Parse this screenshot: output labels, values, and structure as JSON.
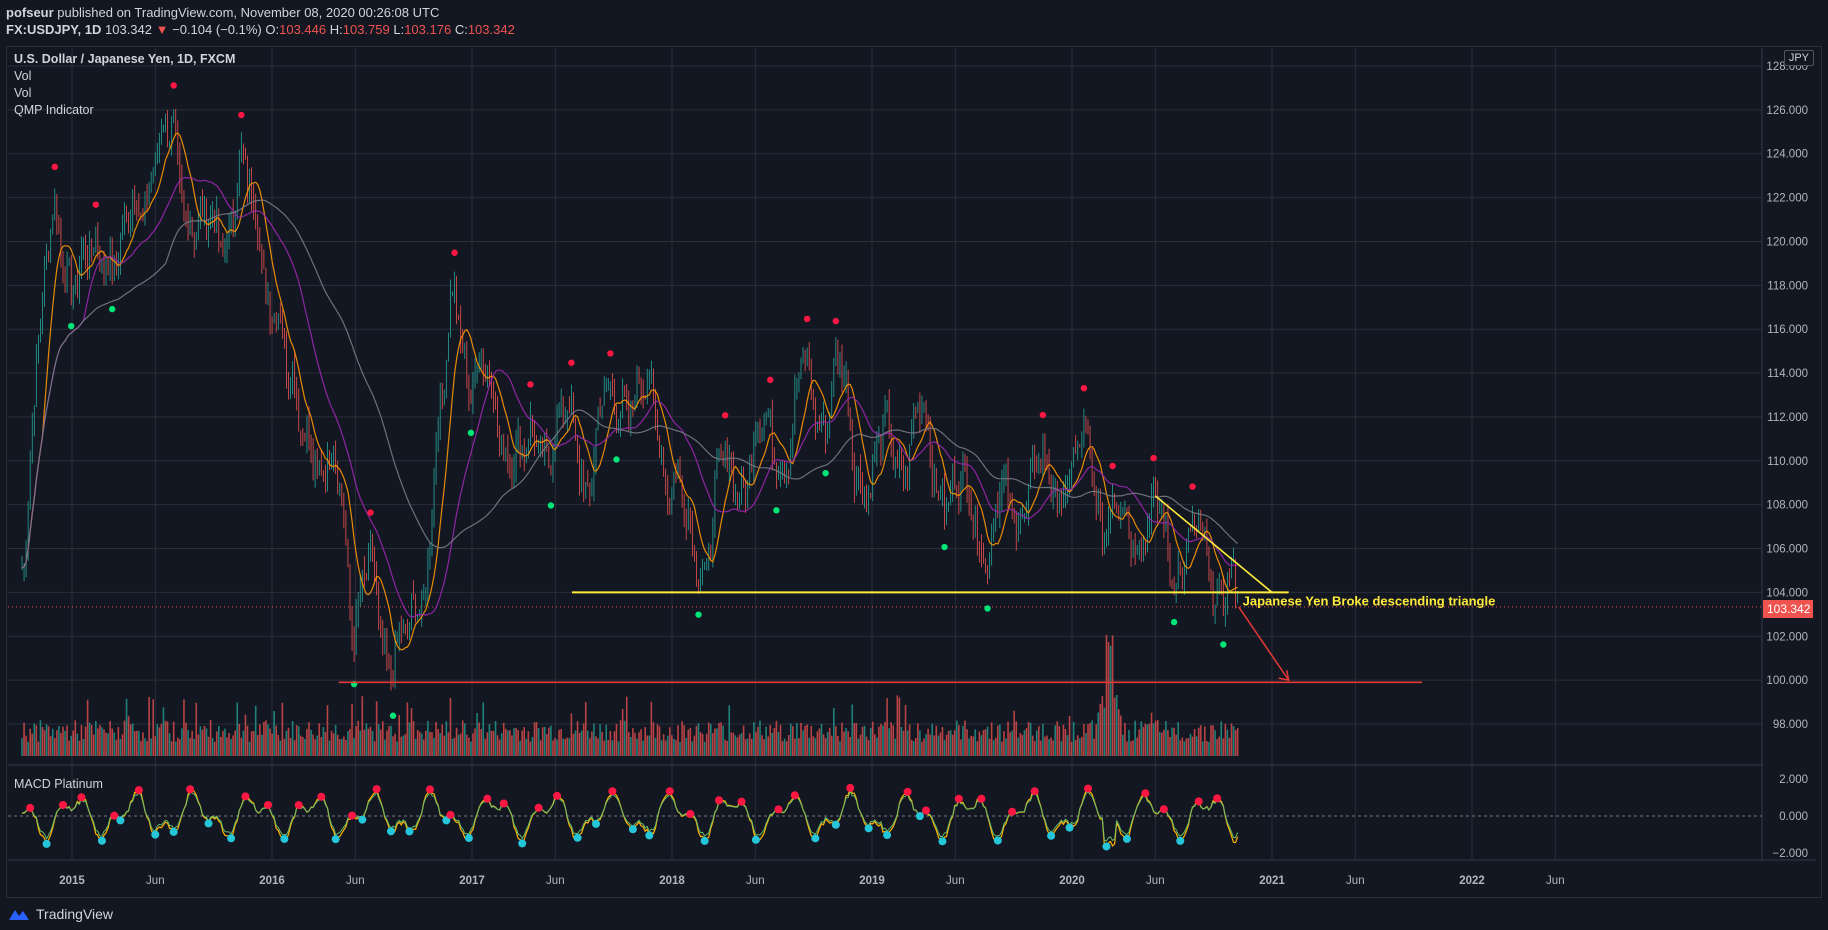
{
  "header": {
    "author": "pofseur",
    "published": "published on TradingView.com, November 08, 2020 00:26:08 UTC",
    "symbol": "FX:USDJPY, 1D",
    "last": "103.342",
    "change_arrow": "▼",
    "change": "−0.104 (−0.1%)",
    "o_label": "O:",
    "o": "103.446",
    "h_label": "H:",
    "h": "103.759",
    "l_label": "L:",
    "l": "103.176",
    "c_label": "C:",
    "c": "103.342"
  },
  "legend": {
    "title": "U.S. Dollar / Japanese Yen, 1D, FXCM",
    "items": [
      "Vol",
      "Vol",
      "QMP Indicator"
    ],
    "macd_title": "MACD Platinum"
  },
  "axis": {
    "currency_label": "JPY",
    "last_price_tag": "103.342",
    "price_ticks": [
      "128.000",
      "126.000",
      "124.000",
      "122.000",
      "120.000",
      "118.000",
      "116.000",
      "114.000",
      "112.000",
      "110.000",
      "108.000",
      "106.000",
      "104.000",
      "102.000",
      "100.000",
      "98.000"
    ],
    "macd_ticks": [
      "2.000",
      "0.000",
      "−2.000"
    ],
    "time_ticks": [
      "2015",
      "Jun",
      "2016",
      "Jun",
      "2017",
      "Jun",
      "2018",
      "Jun",
      "2019",
      "Jun",
      "2020",
      "Jun",
      "2021",
      "Jun",
      "2022",
      "Jun"
    ]
  },
  "annotation": {
    "text": "Japanese Yen Broke descending triangle"
  },
  "footer": {
    "brand": "TradingView"
  },
  "colors": {
    "background": "#131722",
    "grid": "#2a2e39",
    "up": "#26a69a",
    "down": "#ef5350",
    "support_line": "#ffeb3b",
    "target_line": "#e53935",
    "ma_fast": "#ff9800",
    "ma_mid": "#9c27b0",
    "ma_slow": "#787b86",
    "signal_up": "#00e676",
    "signal_down": "#ff1744",
    "macd_low": "#26c6da"
  },
  "chart_data": {
    "type": "line",
    "title": "U.S. Dollar / Japanese Yen, 1D, FXCM",
    "ylim": [
      96.5,
      129
    ],
    "x_range": [
      "2014-10",
      "2022-09"
    ],
    "price_path": [
      [
        "2014-10",
        106.0
      ],
      [
        "2014-11",
        116.0
      ],
      [
        "2014-12",
        120.5
      ],
      [
        "2015-01",
        119.0
      ],
      [
        "2015-02",
        118.5
      ],
      [
        "2015-03",
        120.0
      ],
      [
        "2015-04",
        119.5
      ],
      [
        "2015-05",
        121.5
      ],
      [
        "2015-06",
        124.5
      ],
      [
        "2015-07",
        124.0
      ],
      [
        "2015-08",
        122.0
      ],
      [
        "2015-09",
        120.0
      ],
      [
        "2015-10",
        120.5
      ],
      [
        "2015-11",
        123.0
      ],
      [
        "2015-12",
        121.0
      ],
      [
        "2016-01",
        118.0
      ],
      [
        "2016-02",
        113.0
      ],
      [
        "2016-03",
        112.5
      ],
      [
        "2016-04",
        108.5
      ],
      [
        "2016-05",
        110.0
      ],
      [
        "2016-06",
        102.5
      ],
      [
        "2016-07",
        104.5
      ],
      [
        "2016-08",
        101.5
      ],
      [
        "2016-09",
        101.0
      ],
      [
        "2016-10",
        104.5
      ],
      [
        "2016-11",
        111.0
      ],
      [
        "2016-12",
        117.5
      ],
      [
        "2017-01",
        114.0
      ],
      [
        "2017-02",
        113.0
      ],
      [
        "2017-03",
        111.5
      ],
      [
        "2017-04",
        109.5
      ],
      [
        "2017-05",
        111.5
      ],
      [
        "2017-06",
        111.0
      ],
      [
        "2017-07",
        111.5
      ],
      [
        "2017-08",
        109.5
      ],
      [
        "2017-09",
        112.0
      ],
      [
        "2017-10",
        113.5
      ],
      [
        "2017-11",
        112.5
      ],
      [
        "2017-12",
        112.5
      ],
      [
        "2018-01",
        109.0
      ],
      [
        "2018-02",
        106.5
      ],
      [
        "2018-03",
        106.0
      ],
      [
        "2018-04",
        109.0
      ],
      [
        "2018-05",
        109.5
      ],
      [
        "2018-06",
        110.5
      ],
      [
        "2018-07",
        111.0
      ],
      [
        "2018-08",
        111.0
      ],
      [
        "2018-09",
        113.5
      ],
      [
        "2018-10",
        112.5
      ],
      [
        "2018-11",
        113.5
      ],
      [
        "2018-12",
        110.5
      ],
      [
        "2019-01",
        109.0
      ],
      [
        "2019-02",
        111.0
      ],
      [
        "2019-03",
        110.5
      ],
      [
        "2019-04",
        111.5
      ],
      [
        "2019-05",
        109.5
      ],
      [
        "2019-06",
        108.0
      ],
      [
        "2019-07",
        108.5
      ],
      [
        "2019-08",
        106.0
      ],
      [
        "2019-09",
        108.0
      ],
      [
        "2019-10",
        108.5
      ],
      [
        "2019-11",
        109.0
      ],
      [
        "2019-12",
        109.5
      ],
      [
        "2020-01",
        109.0
      ],
      [
        "2020-02",
        110.5
      ],
      [
        "2020-03",
        107.5
      ],
      [
        "2020-04",
        107.0
      ],
      [
        "2020-05",
        107.5
      ],
      [
        "2020-06",
        107.0
      ],
      [
        "2020-07",
        105.8
      ],
      [
        "2020-08",
        106.0
      ],
      [
        "2020-09",
        105.5
      ],
      [
        "2020-10",
        104.6
      ],
      [
        "2020-11",
        103.342
      ]
    ],
    "support_line": {
      "value": 104.0,
      "from": "2017-07",
      "to": "2021-02"
    },
    "target_line": {
      "value": 99.9,
      "from": "2016-05",
      "to": "2021-10"
    },
    "triangle_upper": [
      [
        "2020-06",
        108.4
      ],
      [
        "2021-01",
        104.0
      ]
    ],
    "projection_arrow": [
      [
        "2020-11",
        103.342
      ],
      [
        "2021-02",
        100.0
      ]
    ],
    "macd_ylim": [
      -2.5,
      2.5
    ]
  }
}
